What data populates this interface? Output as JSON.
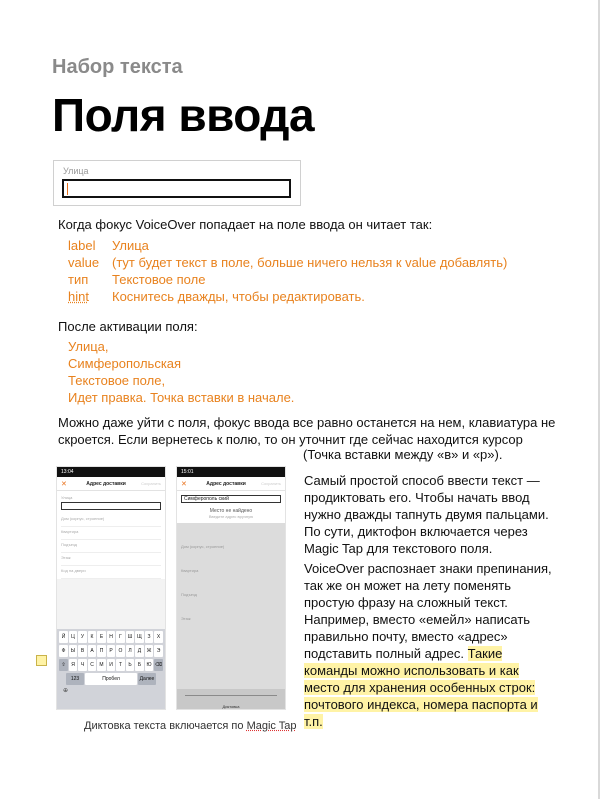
{
  "header": {
    "section": "Набор текста",
    "title": "Поля ввода"
  },
  "field_demo": {
    "label": "Улица"
  },
  "intro": "Когда фокус VoiceOver попадает на поле ввода он читает так:",
  "attributes": [
    {
      "key": "label",
      "value": "Улица"
    },
    {
      "key": "value",
      "value": "(тут будет текст в поле, больше ничего нельзя к value добавлять)"
    },
    {
      "key": "тип",
      "value": "Текстовое поле"
    },
    {
      "key": "hint",
      "value": "Коснитесь дважды, чтобы редактировать."
    }
  ],
  "after_activation": "После активации поля:",
  "announcement": [
    "Улица,",
    "Симферопольская",
    "Текстовое поле,",
    "Идет правка. Точка вставки в начале."
  ],
  "paragraph3": "Можно даже уйти с поля, фокус ввода все равно останется на нем, клавиатура не скроется. Если вернетесь к полю, то он уточнит где сейчас находится курсор",
  "paragraph3_tail": "(Точка вставки между «в» и «р»).",
  "phone1": {
    "status": "13:04",
    "nav_title": "Адрес доставки",
    "nav_right": "Сохранить",
    "input_label": "Улица",
    "rows": [
      "Дом (корпус, строение)",
      "Квартира",
      "Подъезд",
      "Этаж",
      "Код на двери"
    ],
    "keyboard": {
      "row1": [
        "Й",
        "Ц",
        "У",
        "К",
        "Е",
        "Н",
        "Г",
        "Ш",
        "Щ",
        "З",
        "Х"
      ],
      "row2": [
        "Ф",
        "Ы",
        "В",
        "А",
        "П",
        "Р",
        "О",
        "Л",
        "Д",
        "Ж",
        "Э"
      ],
      "row3": [
        "Я",
        "Ч",
        "С",
        "М",
        "И",
        "Т",
        "Ь",
        "Б",
        "Ю"
      ],
      "key_123": "123",
      "key_space": "Пробел",
      "key_done": "Далее"
    }
  },
  "phone2": {
    "status": "15:01",
    "nav_title": "Адрес доставки",
    "nav_right": "Сохранить",
    "input_label": "Улица",
    "input_value": "Симферополь ский",
    "popup_title": "Место не найдено",
    "popup_sub": "Введите адрес вручную",
    "rows": [
      "Дом (корпус, строение)",
      "Квартира",
      "Подъезд",
      "Этаж"
    ],
    "mic_label": "Диктовка"
  },
  "caption": {
    "text": "Диктовка текста включается по ",
    "link": "Magic Tap"
  },
  "right_column": {
    "p1": "Самый простой способ ввести текст — продиктовать его. Чтобы начать ввод нужно дважды тапнуть двумя пальцами. По сути, диктофон включается через Magic Tap для текстового поля.",
    "p2": "VoiceOver распознает знаки препинания, так же он может на лету поменять простую фразу на сложный текст. Например, вместо «емейл» написать правильно почту, вместо «адрес» подставить полный адрес.",
    "p2_highlight": "Такие команды можно использовать и как место для хранения особенных строк: почтового индекса, номера паспорта и т.п."
  }
}
